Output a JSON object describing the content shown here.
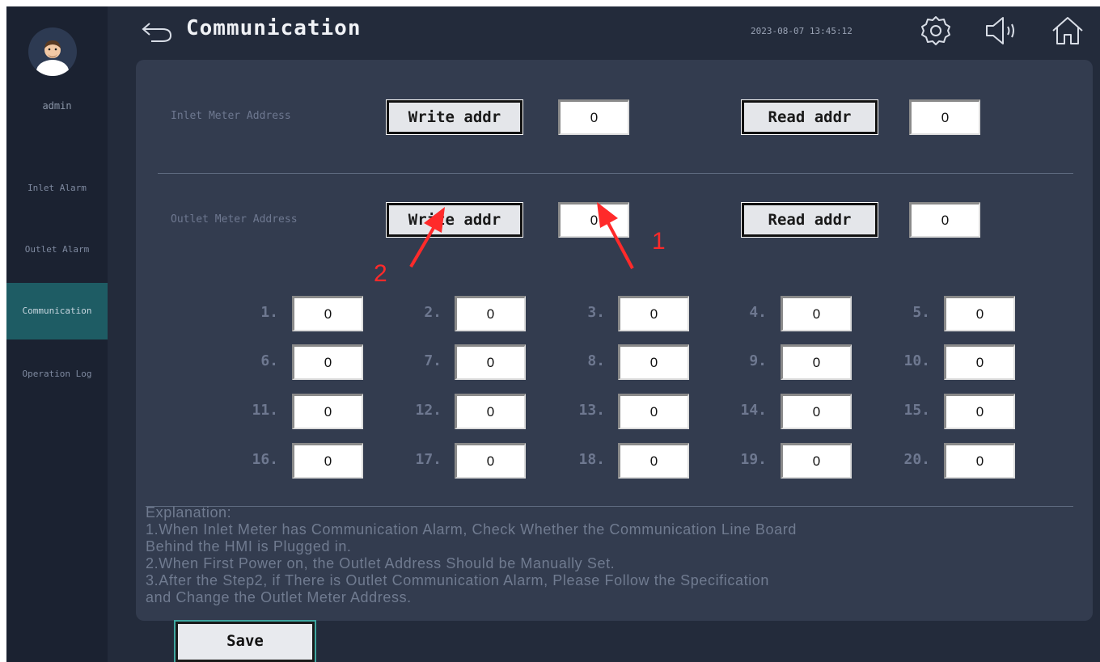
{
  "colors": {
    "accent": "#1e5c64",
    "background": "#232b3b",
    "panel": "#333c4f",
    "annotation": "#ff2a2a"
  },
  "sidebar": {
    "username": "admin",
    "items": [
      {
        "label": "Inlet Alarm",
        "active": false
      },
      {
        "label": "Outlet Alarm",
        "active": false
      },
      {
        "label": "Communication",
        "active": true
      },
      {
        "label": "Operation Log",
        "active": false
      }
    ]
  },
  "header": {
    "title": "Communication",
    "datetime": "2023-08-07 13:45:12",
    "icons": [
      "back-icon",
      "gear-icon",
      "speaker-icon",
      "home-icon"
    ]
  },
  "inlet": {
    "label": "Inlet Meter Address",
    "write_label": "Write addr",
    "write_value": "0",
    "read_label": "Read addr",
    "read_value": "0"
  },
  "outlet": {
    "label": "Outlet Meter Address",
    "write_label": "Write addr",
    "write_value": "0",
    "read_label": "Read addr",
    "read_value": "0"
  },
  "addresses": [
    {
      "label": "1.",
      "value": "0"
    },
    {
      "label": "2.",
      "value": "0"
    },
    {
      "label": "3.",
      "value": "0"
    },
    {
      "label": "4.",
      "value": "0"
    },
    {
      "label": "5.",
      "value": "0"
    },
    {
      "label": "6.",
      "value": "0"
    },
    {
      "label": "7.",
      "value": "0"
    },
    {
      "label": "8.",
      "value": "0"
    },
    {
      "label": "9.",
      "value": "0"
    },
    {
      "label": "10.",
      "value": "0"
    },
    {
      "label": "11.",
      "value": "0"
    },
    {
      "label": "12.",
      "value": "0"
    },
    {
      "label": "13.",
      "value": "0"
    },
    {
      "label": "14.",
      "value": "0"
    },
    {
      "label": "15.",
      "value": "0"
    },
    {
      "label": "16.",
      "value": "0"
    },
    {
      "label": "17.",
      "value": "0"
    },
    {
      "label": "18.",
      "value": "0"
    },
    {
      "label": "19.",
      "value": "0"
    },
    {
      "label": "20.",
      "value": "0"
    }
  ],
  "explanation": {
    "lines": [
      "Explanation:",
      "1.When Inlet Meter has Communication Alarm, Check Whether  the Communication Line Board",
      "Behind the HMI is Plugged in.",
      "2.When First Power on, the Outlet Address Should be Manually Set.",
      "3.After the Step2, if There is Outlet Communication Alarm, Please Follow the Specification",
      "and Change the Outlet Meter Address."
    ]
  },
  "save_label": "Save",
  "annotations": {
    "one": "1",
    "two": "2"
  }
}
